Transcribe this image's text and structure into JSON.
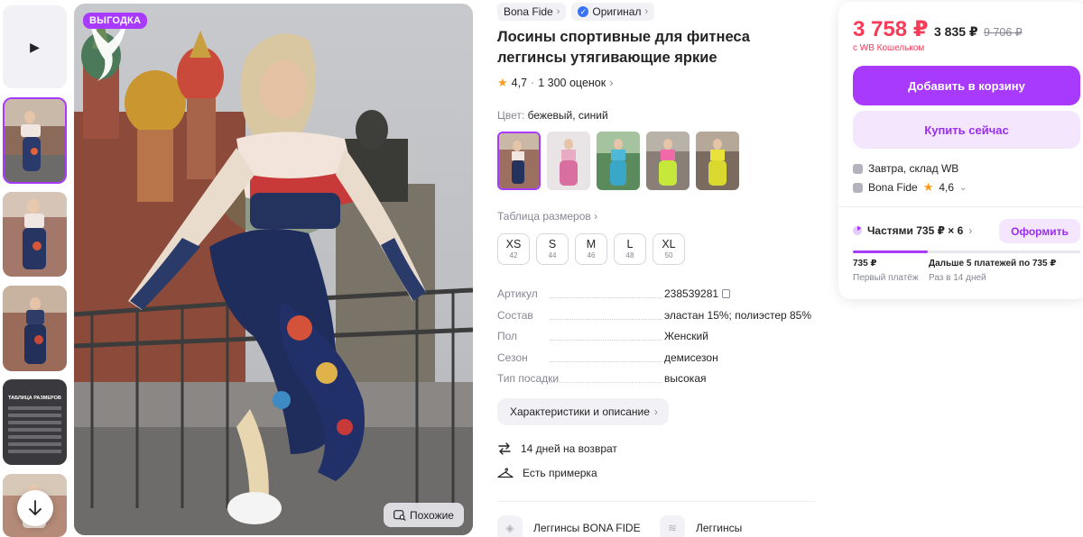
{
  "gallery": {
    "play_glyph": "▶",
    "thumb_size_chart_label": "ТАБЛИЦА РАЗМЕРОВ",
    "promo_badge": "ВЫГОДКА",
    "similar_button": "Похожие"
  },
  "product": {
    "brand": "Bona Fide",
    "original_badge": "Оригинал",
    "title": "Лосины спортивные для фитнеса леггинсы утягивающие яркие",
    "rating": "4,7",
    "reviews": "1 300 оценок",
    "color_label": "Цвет:",
    "color_value": "бежевый, синий",
    "size_table_link": "Таблица размеров",
    "sizes": [
      {
        "label": "XS",
        "ru": "42"
      },
      {
        "label": "S",
        "ru": "44"
      },
      {
        "label": "M",
        "ru": "46"
      },
      {
        "label": "L",
        "ru": "48"
      },
      {
        "label": "XL",
        "ru": "50"
      }
    ],
    "specs": [
      {
        "key": "Артикул",
        "value": "238539281"
      },
      {
        "key": "Состав",
        "value": "эластан 15%; полиэстер 85%"
      },
      {
        "key": "Пол",
        "value": "Женский"
      },
      {
        "key": "Сезон",
        "value": "демисезон"
      },
      {
        "key": "Тип посадки",
        "value": "высокая"
      }
    ],
    "description_button": "Характеристики и описание",
    "features": [
      {
        "label": "14 дней на возврат",
        "icon": "return-arrows-icon"
      },
      {
        "label": "Есть примерка",
        "icon": "hanger-icon"
      }
    ],
    "links": [
      {
        "label": "Леггинсы BONA FIDE",
        "icon": "tag-icon"
      },
      {
        "label": "Леггинсы",
        "icon": "layers-icon"
      }
    ]
  },
  "price_card": {
    "price": "3 758 ₽",
    "price_before_wallet": "3 835 ₽",
    "price_old": "9 706 ₽",
    "wallet_note": "с WB Кошельком",
    "add_to_cart": "Добавить в корзину",
    "buy_now": "Купить сейчас",
    "delivery": "Завтра, склад WB",
    "seller": "Bona Fide",
    "seller_rating": "4,6",
    "installments": "Частями 735 ₽ × 6",
    "checkout_button": "Оформить",
    "installment_progress": 0.33,
    "first_payment_amount": "735 ₽",
    "first_payment_label": "Первый платёж",
    "next_payments_amount": "Дальше 5 платежей по 735 ₽",
    "next_payments_label": "Раз в 14 дней"
  },
  "colors": {
    "accent": "#a73afd",
    "price_red": "#f73b58",
    "muted": "#868695"
  }
}
